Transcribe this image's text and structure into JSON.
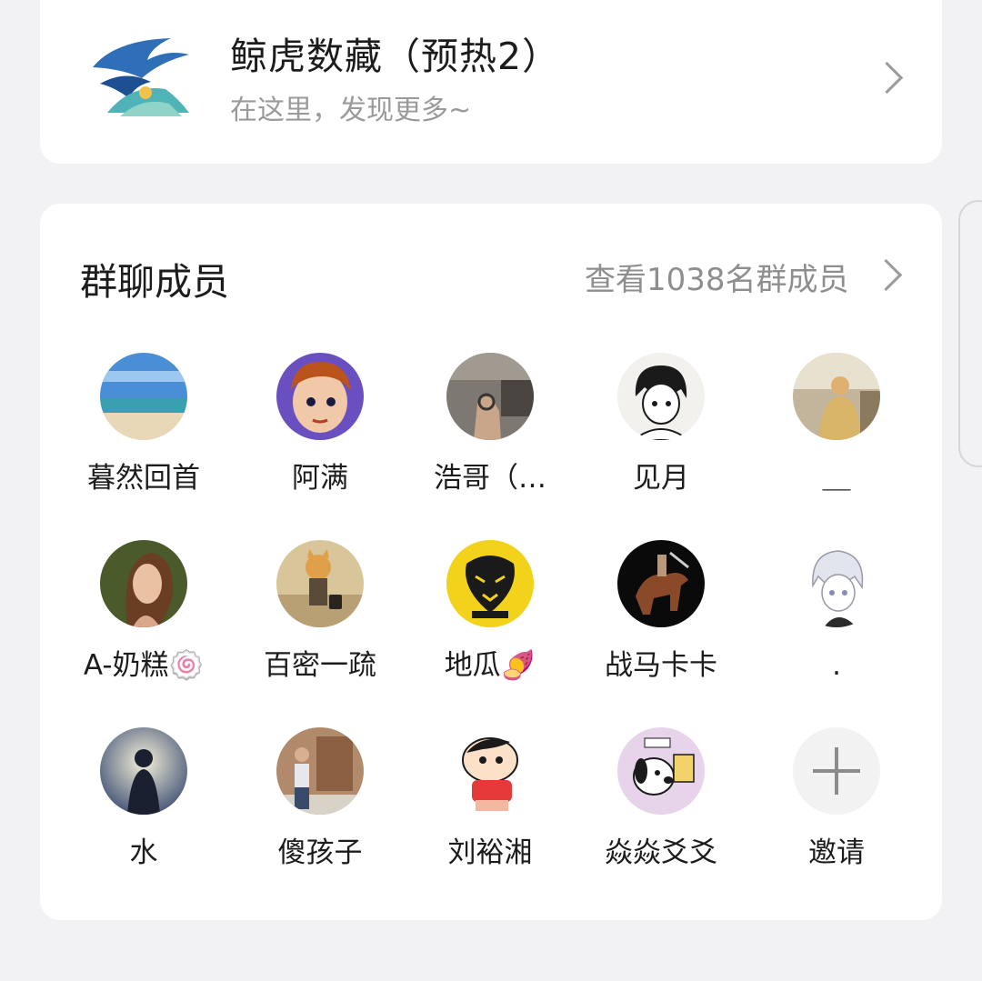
{
  "group": {
    "title": "鲸虎数藏（预热2）",
    "subtitle": "在这里，发现更多~",
    "logo_icon": "whale-wave-logo"
  },
  "members": {
    "title": "群聊成员",
    "view_all_label": "查看1038名群成员",
    "list": [
      {
        "name": "暮然回首",
        "icon": "avatar-beach"
      },
      {
        "name": "阿满",
        "icon": "avatar-pixel-anime"
      },
      {
        "name": "浩哥（…",
        "icon": "avatar-hand-photo"
      },
      {
        "name": "见月",
        "icon": "avatar-anime-boy"
      },
      {
        "name": "＿",
        "icon": "avatar-man-sunset"
      },
      {
        "name": "A-奶糕🍥",
        "icon": "avatar-woman-profile"
      },
      {
        "name": "百密一疏",
        "icon": "avatar-cat-suit"
      },
      {
        "name": "地瓜🍠",
        "icon": "avatar-yellow-tiger"
      },
      {
        "name": "战马卡卡",
        "icon": "avatar-horse-rider"
      },
      {
        "name": ".",
        "icon": "avatar-anime-sketch"
      },
      {
        "name": "水",
        "icon": "avatar-silhouette"
      },
      {
        "name": "傻孩子",
        "icon": "avatar-man-wall"
      },
      {
        "name": "刘裕湘",
        "icon": "avatar-crayon-kid"
      },
      {
        "name": "焱焱爻爻",
        "icon": "avatar-dog-cartoon"
      }
    ],
    "invite_label": "邀请"
  }
}
